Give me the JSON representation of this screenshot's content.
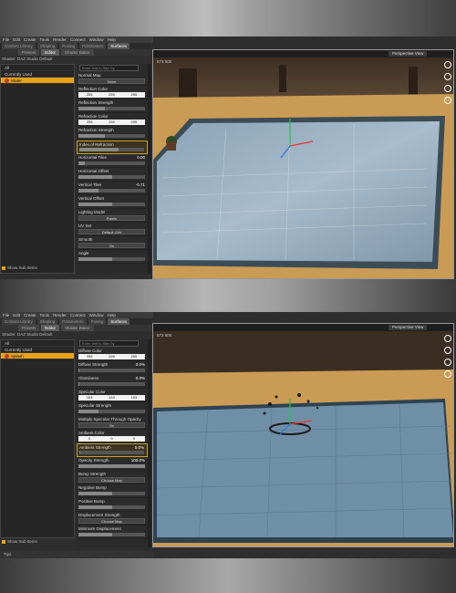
{
  "menu": [
    "File",
    "Edit",
    "Create",
    "Tools",
    "Render",
    "Connect",
    "Window",
    "Help"
  ],
  "tabs1": [
    "Content Library",
    "Shaping",
    "Posing",
    "Parameters",
    "Surfaces"
  ],
  "tabs2": [
    "Content Library",
    "Shaping",
    "Parameters",
    "Posing",
    "Surfaces"
  ],
  "subtabs": [
    "Presets",
    "Editor",
    "Shader Baker"
  ],
  "shader": "Shader: DAZ Studio Default",
  "search_placeholder": "Enter text to filter by",
  "list": {
    "all": "All",
    "used": "Currently Used"
  },
  "shot1": {
    "selected": "Water",
    "props": [
      {
        "label": "Normal Map",
        "btn": "None"
      },
      {
        "label": "Reflection Color",
        "color": [
          "255",
          "255",
          "255"
        ]
      },
      {
        "label": "Reflection Strength",
        "slider": 0.4
      },
      {
        "label": "Refraction Color",
        "color": [
          "255",
          "255",
          "255"
        ]
      },
      {
        "label": "Refraction Strength",
        "slider": 0.4
      },
      {
        "label": "Index of Refraction",
        "slider": 0.6,
        "hl": true
      },
      {
        "label": "Horizontal Tiles",
        "value": "0.00",
        "slider": 0.1
      },
      {
        "label": "Horizontal Offset",
        "slider": 0.5
      },
      {
        "label": "Vertical Tiles",
        "value": "-0.71",
        "slider": 0.3
      },
      {
        "label": "Vertical Offset",
        "slider": 0.5
      },
      {
        "label": "Lighting Model",
        "btn": "Plastic"
      },
      {
        "label": "UV Set",
        "btn": "Default UVs"
      },
      {
        "label": "Smooth",
        "btn": "On"
      },
      {
        "label": "Angle",
        "slider": 0.5
      }
    ],
    "coords": "673 500"
  },
  "shot2": {
    "selected": "Splash",
    "props": [
      {
        "label": "Diffuse Color",
        "color": [
          "255",
          "255",
          "255"
        ]
      },
      {
        "label": "Diffuse Strength",
        "value": "0.0%",
        "slider": 0.02
      },
      {
        "label": "Glossiness",
        "value": "0.0%",
        "slider": 0.02
      },
      {
        "label": "Specular Color",
        "color": [
          "153",
          "153",
          "153"
        ]
      },
      {
        "label": "Specular Strength",
        "slider": 0.3
      },
      {
        "label": "Multiply Specular Through Opacity",
        "btn": "On"
      },
      {
        "label": "Ambient Color",
        "color": [
          "0",
          "0",
          "0"
        ]
      },
      {
        "label": "Ambient Strength",
        "value": "0.0%",
        "slider": 0.02,
        "hl": true
      },
      {
        "label": "Opacity Strength",
        "value": "100.0%",
        "slider": 1.0
      },
      {
        "label": "Bump Strength",
        "btn": "Choose Map"
      },
      {
        "label": "Negative Bump",
        "slider": 0.5
      },
      {
        "label": "Positive Bump",
        "slider": 0.5
      },
      {
        "label": "Displacement Strength",
        "btn": "Choose Map"
      },
      {
        "label": "Minimum Displacement",
        "slider": 0.5
      }
    ],
    "coords": "673 500"
  },
  "viewport_label": "Perspective View",
  "show_sub": "Show Sub Items",
  "status": "Tips",
  "colors": {
    "accent": "#e8a317",
    "sand": "#c99b55",
    "water": "#6f8fa6"
  }
}
